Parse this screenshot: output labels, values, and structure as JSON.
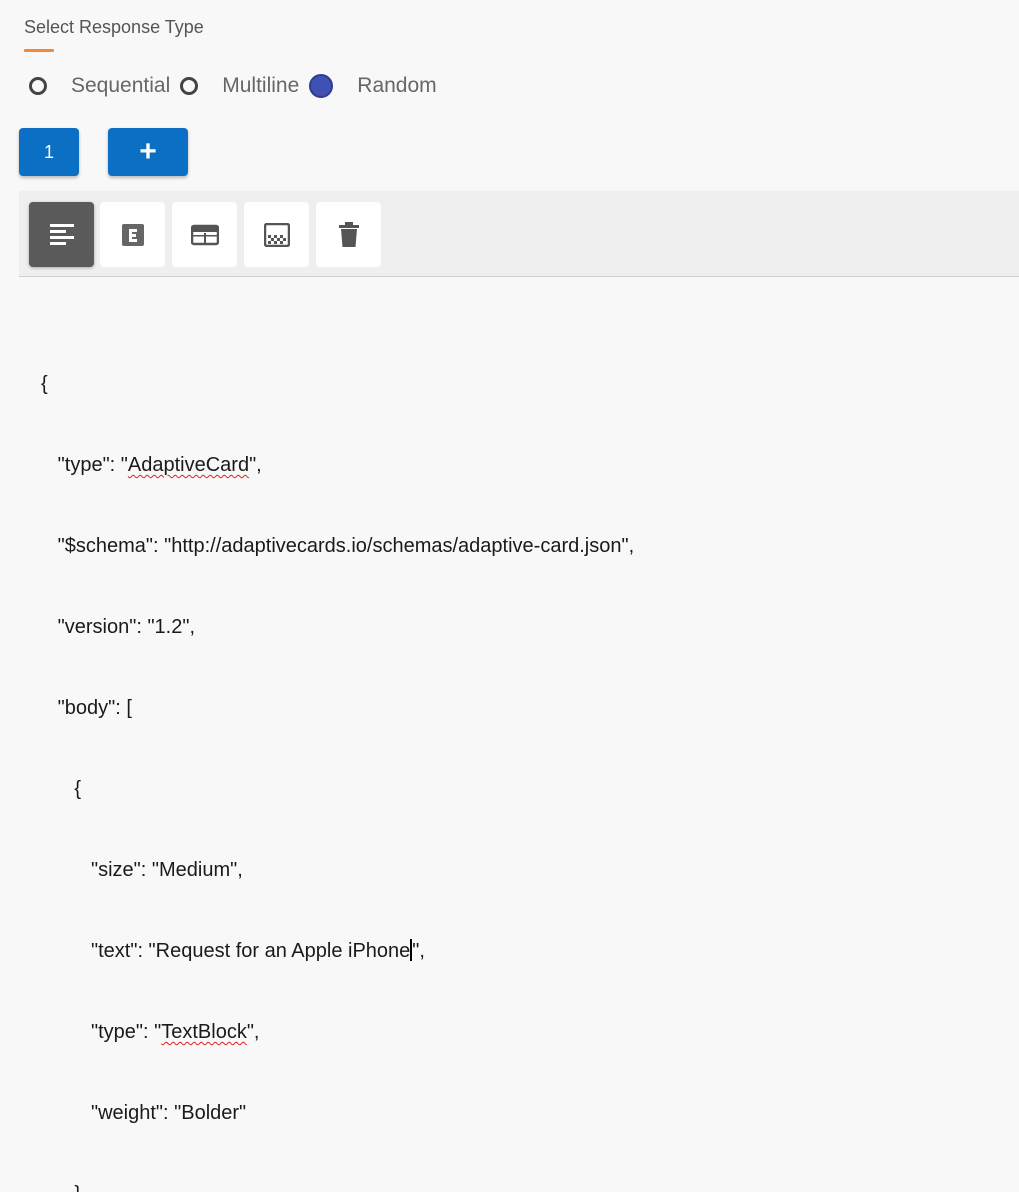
{
  "section": {
    "title": "Select Response Type"
  },
  "response_types": [
    {
      "label": "Sequential",
      "selected": false
    },
    {
      "label": "Multiline",
      "selected": false
    },
    {
      "label": "Random",
      "selected": true
    }
  ],
  "buttons": {
    "tab_one_label": "1",
    "add_label": "+"
  },
  "toolbar": {
    "tools": [
      {
        "icon": "text-align-left-icon",
        "active": true
      },
      {
        "icon": "letter-e-icon",
        "active": false
      },
      {
        "icon": "card-layout-icon",
        "active": false
      },
      {
        "icon": "image-grid-icon",
        "active": false
      },
      {
        "icon": "trash-icon",
        "active": false
      }
    ]
  },
  "editor": {
    "l1": "{",
    "l2a": "   \"type\": \"",
    "l2b": "AdaptiveCard",
    "l2c": "\",",
    "l3": "   \"$schema\": \"http://adaptivecards.io/schemas/adaptive-card.json\",",
    "l4": "   \"version\": \"1.2\",",
    "l5": "   \"body\": [",
    "l6": "      {",
    "l7": "         \"size\": \"Medium\",",
    "l8a": "         \"text\": \"Request for an Apple iPhone",
    "l8b": "\",",
    "l9a": "         \"type\": \"",
    "l9b": "TextBlock",
    "l9c": "\",",
    "l10": "         \"weight\": \"Bolder\"",
    "l11": "      },"
  },
  "colors": {
    "accent_orange": "#f08a3b",
    "button_blue": "#0b6fc4",
    "radio_selected": "#3f51b5"
  }
}
